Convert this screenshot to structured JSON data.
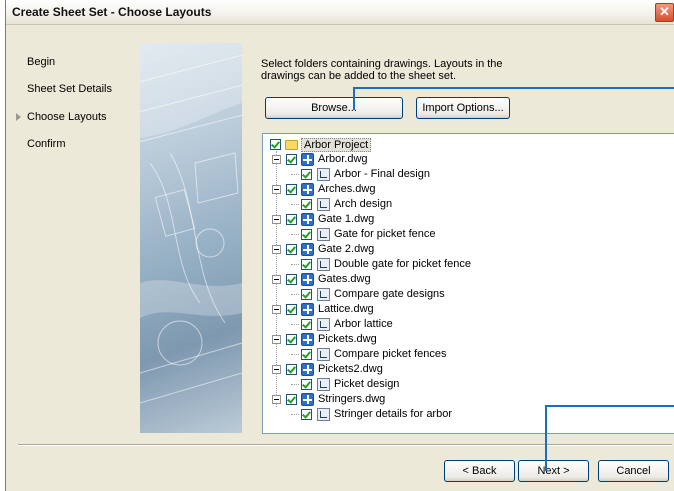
{
  "window": {
    "title": "Create Sheet Set - Choose Layouts",
    "close_glyph": "✕"
  },
  "steps": [
    {
      "label": "Begin",
      "current": false
    },
    {
      "label": "Sheet Set Details",
      "current": false
    },
    {
      "label": "Choose Layouts",
      "current": true
    },
    {
      "label": "Confirm",
      "current": false
    }
  ],
  "instructions": "Select folders containing drawings.  Layouts in the drawings can be added to the sheet set.",
  "buttons": {
    "browse": "Browse...",
    "import_options": "Import Options...",
    "back": "< Back",
    "next": "Next >",
    "cancel": "Cancel"
  },
  "tree": {
    "root": {
      "label": "Arbor Project",
      "checked": true,
      "icon": "folder-icon"
    },
    "drawings": [
      {
        "label": "Arbor.dwg",
        "layouts": [
          "Arbor - Final design"
        ]
      },
      {
        "label": "Arches.dwg",
        "layouts": [
          "Arch design"
        ]
      },
      {
        "label": "Gate 1.dwg",
        "layouts": [
          "Gate for picket fence"
        ]
      },
      {
        "label": "Gate 2.dwg",
        "layouts": [
          "Double gate for picket fence"
        ]
      },
      {
        "label": "Gates.dwg",
        "layouts": [
          "Compare gate designs"
        ]
      },
      {
        "label": "Lattice.dwg",
        "layouts": [
          "Arbor lattice"
        ]
      },
      {
        "label": "Pickets.dwg",
        "layouts": [
          "Compare picket fences"
        ]
      },
      {
        "label": "Pickets2.dwg",
        "layouts": [
          "Picket design"
        ]
      },
      {
        "label": "Stringers.dwg",
        "layouts": [
          "Stringer details for arbor"
        ]
      }
    ]
  },
  "colors": {
    "dialog_bg": "#ece9d8",
    "callout": "#1b6fc0",
    "checkmark": "#21a121"
  }
}
